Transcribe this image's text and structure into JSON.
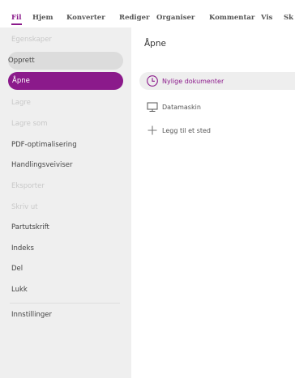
{
  "menubar": {
    "items": [
      "Fil",
      "Hjem",
      "Konverter",
      "Rediger",
      "Organiser",
      "Kommentar",
      "Vis",
      "Sk"
    ]
  },
  "sidebar": {
    "items": [
      {
        "label": "Egenskaper",
        "state": "disabled"
      },
      {
        "label": "Opprett",
        "state": "hover"
      },
      {
        "label": "Åpne",
        "state": "selected"
      },
      {
        "label": "Lagre",
        "state": "disabled"
      },
      {
        "label": "Lagre som",
        "state": "disabled"
      },
      {
        "label": "PDF-optimalisering",
        "state": "normal"
      },
      {
        "label": "Handlingsveiviser",
        "state": "normal"
      },
      {
        "label": "Eksporter",
        "state": "disabled"
      },
      {
        "label": "Skriv ut",
        "state": "disabled"
      },
      {
        "label": "Partutskrift",
        "state": "normal"
      },
      {
        "label": "Indeks",
        "state": "normal"
      },
      {
        "label": "Del",
        "state": "normal"
      },
      {
        "label": "Lukk",
        "state": "normal"
      },
      {
        "label": "Innstillinger",
        "state": "normal"
      }
    ]
  },
  "main": {
    "title": "Åpne",
    "locations": [
      {
        "label": "Nylige dokumenter",
        "icon": "clock-icon",
        "active": true
      },
      {
        "label": "Datamaskin",
        "icon": "monitor-icon",
        "active": false
      },
      {
        "label": "Legg til et sted",
        "icon": "plus-icon",
        "active": false
      }
    ]
  },
  "colors": {
    "accent": "#8b1a8b",
    "sidebar_bg": "#efefef",
    "hover_bg": "#dcdcdc",
    "disabled_text": "#c8c8c8"
  }
}
